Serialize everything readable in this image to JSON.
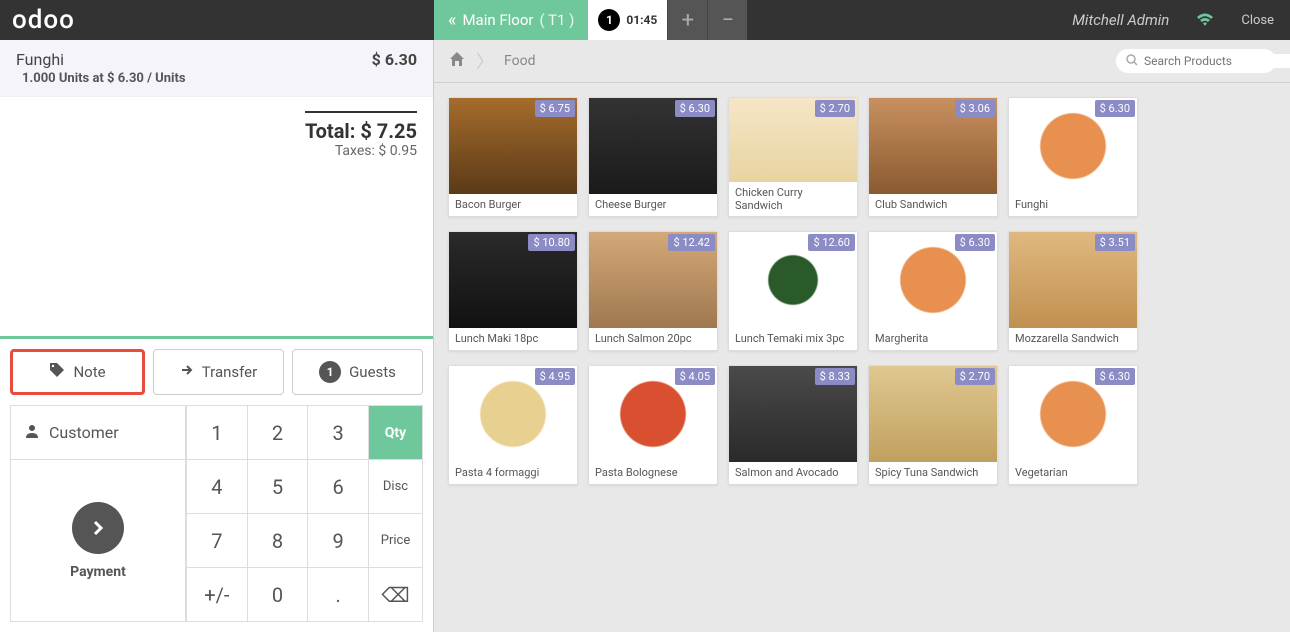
{
  "header": {
    "logo": "odoo",
    "floor_label": "Main Floor",
    "table_label": "( T1 )",
    "order_number": "1",
    "order_time": "01:45",
    "user": "Mitchell Admin",
    "close": "Close"
  },
  "order": {
    "item_name": "Funghi",
    "item_price": "$ 6.30",
    "item_qty_line": "1.000 Units at $ 6.30 / Units",
    "total_label": "Total:",
    "total_value": "$ 7.25",
    "tax_label": "Taxes:",
    "tax_value": "$ 0.95"
  },
  "actions": {
    "note": "Note",
    "transfer": "Transfer",
    "guests": "Guests",
    "guests_count": "1",
    "customer": "Customer",
    "payment": "Payment"
  },
  "numpad": {
    "qty": "Qty",
    "disc": "Disc",
    "price": "Price",
    "k1": "1",
    "k2": "2",
    "k3": "3",
    "k4": "4",
    "k5": "5",
    "k6": "6",
    "k7": "7",
    "k8": "8",
    "k9": "9",
    "k0": "0",
    "pm": "+/-",
    "dot": ".",
    "del": "⌫"
  },
  "breadcrumb": {
    "category": "Food"
  },
  "search": {
    "placeholder": "Search Products"
  },
  "products": [
    {
      "name": "Bacon Burger",
      "price": "$ 6.75",
      "img": "img-burger"
    },
    {
      "name": "Cheese Burger",
      "price": "$ 6.30",
      "img": "img-burger2"
    },
    {
      "name": "Chicken Curry Sandwich",
      "price": "$ 2.70",
      "img": "img-sandwich"
    },
    {
      "name": "Club Sandwich",
      "price": "$ 3.06",
      "img": "img-club"
    },
    {
      "name": "Funghi",
      "price": "$ 6.30",
      "img": "img-pizza"
    },
    {
      "name": "Lunch Maki 18pc",
      "price": "$ 10.80",
      "img": "img-sushi1"
    },
    {
      "name": "Lunch Salmon 20pc",
      "price": "$ 12.42",
      "img": "img-sushi2"
    },
    {
      "name": "Lunch Temaki mix 3pc",
      "price": "$ 12.60",
      "img": "img-temaki"
    },
    {
      "name": "Margherita",
      "price": "$ 6.30",
      "img": "img-pizza"
    },
    {
      "name": "Mozzarella Sandwich",
      "price": "$ 3.51",
      "img": "img-mozz"
    },
    {
      "name": "Pasta 4 formaggi",
      "price": "$ 4.95",
      "img": "img-pasta1"
    },
    {
      "name": "Pasta Bolognese",
      "price": "$ 4.05",
      "img": "img-pasta2"
    },
    {
      "name": "Salmon and Avocado",
      "price": "$ 8.33",
      "img": "img-salmon"
    },
    {
      "name": "Spicy Tuna Sandwich",
      "price": "$ 2.70",
      "img": "img-spicy"
    },
    {
      "name": "Vegetarian",
      "price": "$ 6.30",
      "img": "img-pizza"
    }
  ]
}
